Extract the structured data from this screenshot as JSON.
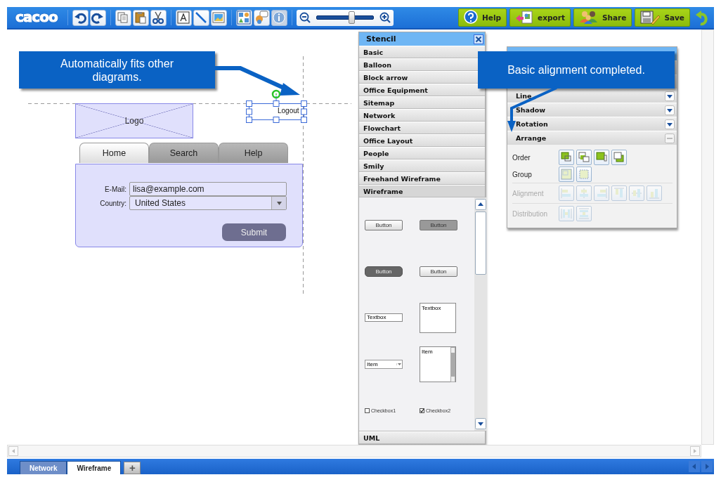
{
  "toolbar": {
    "logo": "cacoo",
    "tool_groups": [
      [
        {
          "kind": "undo",
          "disabled": false
        },
        {
          "kind": "redo",
          "disabled": false
        }
      ],
      [
        {
          "kind": "copy",
          "disabled": false
        },
        {
          "kind": "paste",
          "disabled": false
        },
        {
          "kind": "cut",
          "disabled": false
        }
      ],
      [
        {
          "kind": "text",
          "disabled": false
        },
        {
          "kind": "line",
          "disabled": false
        },
        {
          "kind": "image",
          "disabled": false
        }
      ],
      [
        {
          "kind": "stencil",
          "disabled": false
        },
        {
          "kind": "comment",
          "disabled": false
        },
        {
          "kind": "info",
          "disabled": true
        }
      ]
    ],
    "zoom": {
      "level": 0.6
    },
    "actions": [
      {
        "kind": "help",
        "label": "Help"
      },
      {
        "kind": "export",
        "label": "export"
      },
      {
        "kind": "share",
        "label": "Share"
      },
      {
        "kind": "save",
        "label": "Save"
      }
    ]
  },
  "canvas": {
    "callouts": [
      {
        "text": "Automatically fits other diagrams."
      },
      {
        "text": "Basic alignment completed."
      }
    ],
    "wireframe": {
      "logo": "Logo",
      "logout": "Logout",
      "tabs": [
        {
          "label": "Home",
          "selected": true
        },
        {
          "label": "Search",
          "selected": false
        },
        {
          "label": "Help",
          "selected": false
        }
      ],
      "fields": [
        {
          "kind": "text",
          "label": "E-Mail:",
          "value": "lisa@example.com"
        },
        {
          "kind": "select",
          "label": "Country:",
          "value": "United States"
        }
      ],
      "submit": "Submit"
    }
  },
  "stencil": {
    "title": "Stencil",
    "categories": [
      {
        "label": "Basic",
        "expanded": false
      },
      {
        "label": "Balloon",
        "expanded": false
      },
      {
        "label": "Block arrow",
        "expanded": false
      },
      {
        "label": "Office Equipment",
        "expanded": false
      },
      {
        "label": "Sitemap",
        "expanded": false
      },
      {
        "label": "Network",
        "expanded": false
      },
      {
        "label": "Flowchart",
        "expanded": false
      },
      {
        "label": "Office Layout",
        "expanded": false
      },
      {
        "label": "People",
        "expanded": false
      },
      {
        "label": "Smily",
        "expanded": false
      },
      {
        "label": "Freehand Wireframe",
        "expanded": false
      },
      {
        "label": "Wireframe",
        "expanded": true
      },
      {
        "label": "UML",
        "expanded": false
      }
    ],
    "items": [
      {
        "kind": "button",
        "label": "Button"
      },
      {
        "kind": "button-pressed",
        "label": "Button"
      },
      {
        "kind": "button-rounded",
        "label": "Button"
      },
      {
        "kind": "button",
        "label": "Button"
      },
      {
        "kind": "textbox",
        "label": "Textbox"
      },
      {
        "kind": "textarea",
        "label": "Textbox"
      },
      {
        "kind": "select",
        "label": "Item"
      },
      {
        "kind": "listbox",
        "label": "Item"
      },
      {
        "kind": "checkbox",
        "label": "Checkbox1",
        "checked": false
      },
      {
        "kind": "checkbox",
        "label": "Checkbox2",
        "checked": true
      }
    ]
  },
  "properties": {
    "sections": [
      {
        "label": "Line",
        "expanded": false
      },
      {
        "label": "Shadow",
        "expanded": false
      },
      {
        "label": "Rotation",
        "expanded": false
      },
      {
        "label": "Arrange",
        "expanded": true
      }
    ],
    "arrange": [
      {
        "label": "Order",
        "disabled": false,
        "tools": [
          {
            "kind": "front"
          },
          {
            "kind": "forward"
          },
          {
            "kind": "backward"
          },
          {
            "kind": "back"
          }
        ]
      },
      {
        "label": "Group",
        "disabled": false,
        "tools": [
          {
            "kind": "group"
          },
          {
            "kind": "ungroup"
          }
        ]
      },
      {
        "label": "Alignment",
        "disabled": true,
        "tools": [
          {
            "kind": "align-left"
          },
          {
            "kind": "align-center"
          },
          {
            "kind": "align-right"
          },
          {
            "kind": "align-top"
          },
          {
            "kind": "align-middle"
          },
          {
            "kind": "align-bottom"
          }
        ]
      },
      {
        "label": "Distribution",
        "disabled": true,
        "tools": [
          {
            "kind": "distribute-h"
          },
          {
            "kind": "distribute-v"
          }
        ]
      }
    ]
  },
  "sheets": {
    "tabs": [
      {
        "label": "Network",
        "selected": false
      },
      {
        "label": "Wireframe",
        "selected": true
      }
    ],
    "add": "+"
  }
}
